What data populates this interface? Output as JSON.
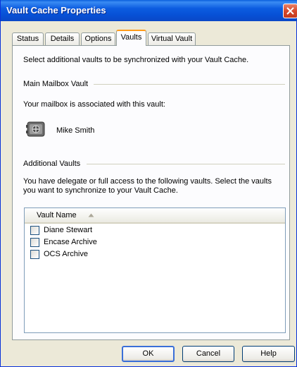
{
  "window": {
    "title": "Vault Cache Properties"
  },
  "tabs": [
    {
      "label": "Status"
    },
    {
      "label": "Details"
    },
    {
      "label": "Options"
    },
    {
      "label": "Vaults",
      "active": true
    },
    {
      "label": "Virtual Vault"
    }
  ],
  "vaults": {
    "intro": "Select additional vaults to be synchronized with your Vault Cache.",
    "main_group_label": "Main Mailbox Vault",
    "main_desc": "Your mailbox is associated with this vault:",
    "main_user_icon": "mailbox-vault-icon",
    "main_user": "Mike Smith",
    "additional_group_label": "Additional Vaults",
    "additional_desc_line1": "You have delegate or full access to the following vaults. Select the vaults",
    "additional_desc_line2": "you want to synchronize to your Vault Cache.",
    "list": {
      "column_header": "Vault Name",
      "sort_icon": "sort-ascending-icon",
      "items": [
        {
          "name": "Diane Stewart",
          "checked": false
        },
        {
          "name": "Encase Archive",
          "checked": false
        },
        {
          "name": "OCS Archive",
          "checked": false
        }
      ]
    }
  },
  "buttons": {
    "ok": "OK",
    "cancel": "Cancel",
    "help": "Help"
  },
  "colors": {
    "title_bar": "#0a5fdc",
    "dialog_bg": "#ece9d8",
    "active_tab_accent": "#ff9b1a",
    "close_button": "#d7492b"
  }
}
